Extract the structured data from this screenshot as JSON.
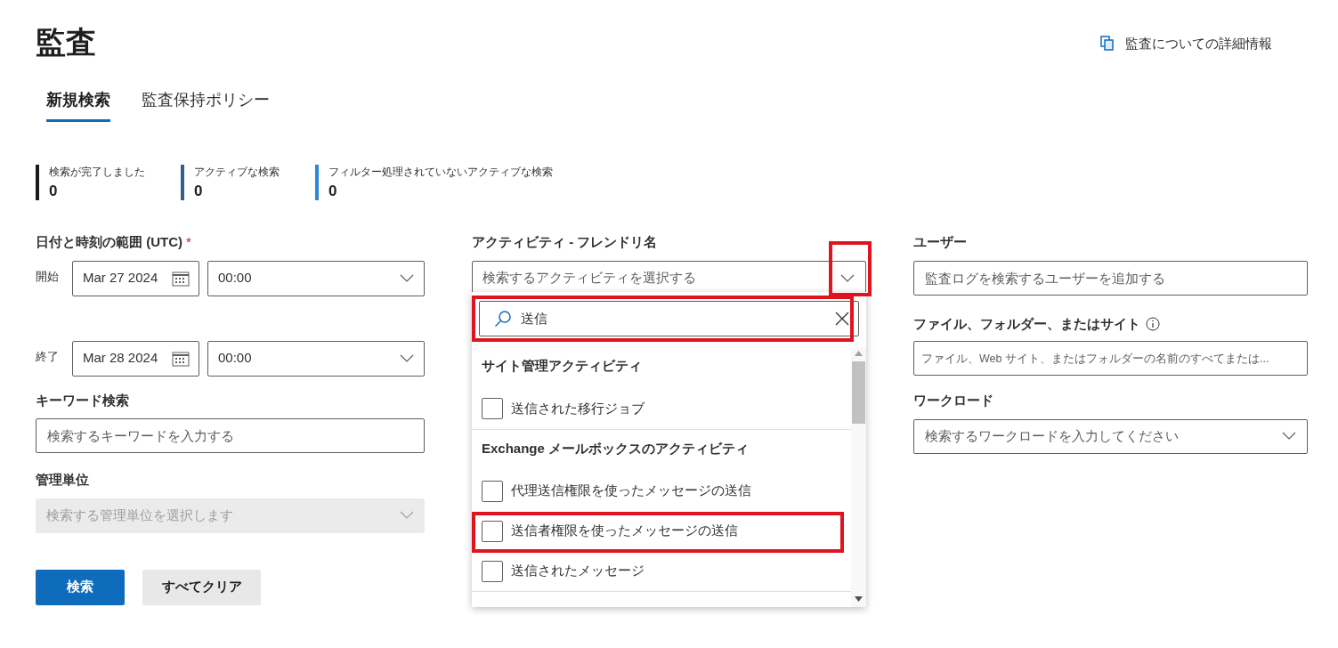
{
  "page": {
    "title": "監査",
    "help_link": "監査についての詳細情報"
  },
  "tabs": [
    {
      "label": "新規検索",
      "selected": true
    },
    {
      "label": "監査保持ポリシー",
      "selected": false
    }
  ],
  "stats": [
    {
      "label": "検索が完了しました",
      "value": "0",
      "color": "#1b1b1b"
    },
    {
      "label": "アクティブな検索",
      "value": "0",
      "color": "#2f5f8a"
    },
    {
      "label": "フィルター処理されていないアクティブな検索",
      "value": "0",
      "color": "#2b88d8"
    }
  ],
  "date_range": {
    "label": "日付と時刻の範囲 (UTC)",
    "required_mark": "*",
    "start": {
      "label": "開始",
      "date": "Mar 27 2024",
      "time": "00:00"
    },
    "end": {
      "label": "終了",
      "date": "Mar 28 2024",
      "time": "00:00"
    }
  },
  "keyword": {
    "label": "キーワード検索",
    "placeholder": "検索するキーワードを入力する"
  },
  "admin_unit": {
    "label": "管理単位",
    "placeholder": "検索する管理単位を選択します",
    "disabled": true
  },
  "buttons": [
    {
      "label": "検索",
      "kind": "primary"
    },
    {
      "label": "すべてクリア",
      "kind": "secondary"
    }
  ],
  "activity": {
    "label": "アクティビティ - フレンドリ名",
    "placeholder": "検索するアクティビティを選択する",
    "expanded": true,
    "chevron_highlighted": true,
    "search": {
      "value": "送信",
      "highlighted": true
    },
    "groups": [
      {
        "title": "サイト管理アクティビティ",
        "options": [
          {
            "label": "送信された移行ジョブ",
            "checked": false,
            "highlighted": false
          }
        ]
      },
      {
        "title": "Exchange メールボックスのアクティビティ",
        "options": [
          {
            "label": "代理送信権限を使ったメッセージの送信",
            "checked": false,
            "highlighted": false
          },
          {
            "label": "送信者権限を使ったメッセージの送信",
            "checked": false,
            "highlighted": true
          },
          {
            "label": "送信されたメッセージ",
            "checked": false,
            "highlighted": false
          }
        ]
      }
    ]
  },
  "user": {
    "label": "ユーザー",
    "placeholder": "監査ログを検索するユーザーを追加する"
  },
  "files": {
    "label": "ファイル、フォルダー、またはサイト",
    "placeholder": "ファイル、Web サイト、またはフォルダーの名前のすべてまたは..."
  },
  "workload": {
    "label": "ワークロード",
    "placeholder": "検索するワークロードを入力してください"
  }
}
